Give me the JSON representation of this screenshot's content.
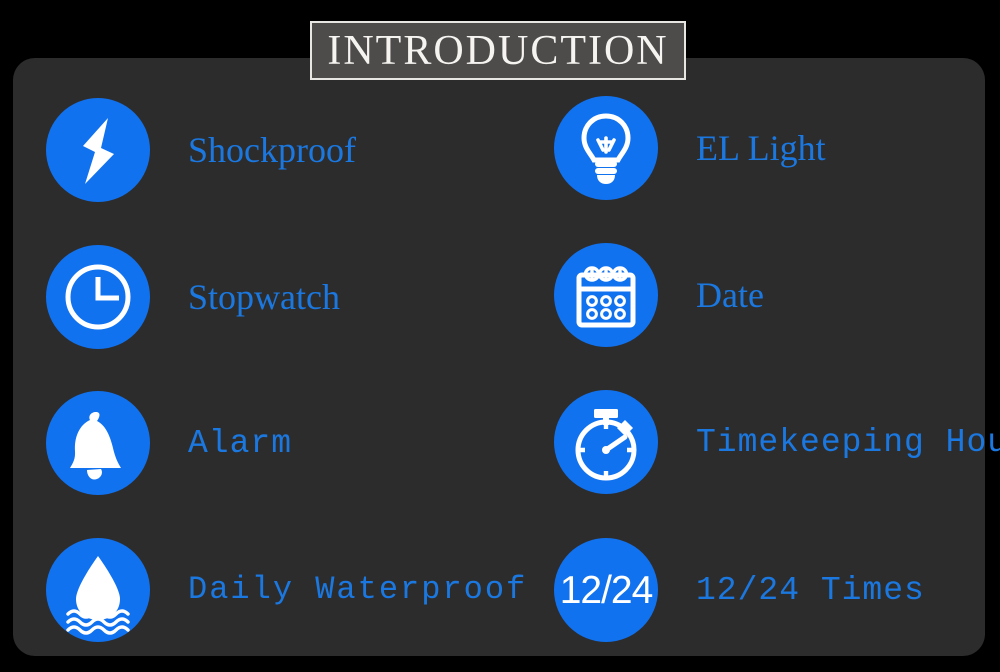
{
  "header": {
    "title": "INTRODUCTION"
  },
  "colors": {
    "page_background": "#000000",
    "panel_background": "#2d2c2c",
    "title_box_background": "#4e4b4b",
    "title_box_border": "#e8e6e3",
    "title_text": "#f6f4f1",
    "icon_circle": "#1172f0",
    "icon_glyph": "#ffffff",
    "label_text": "#1a78e0"
  },
  "features": {
    "left_column": [
      {
        "label": "Shockproof",
        "icon": "lightning-bolt-icon"
      },
      {
        "label": "Stopwatch",
        "icon": "clock-icon"
      },
      {
        "label": "Alarm",
        "icon": "bell-icon"
      },
      {
        "label": "Daily Waterproof",
        "icon": "water-drop-icon"
      }
    ],
    "right_column": [
      {
        "label": "EL Light",
        "icon": "light-bulb-icon"
      },
      {
        "label": "Date",
        "icon": "calendar-icon"
      },
      {
        "label": "Timekeeping Hour",
        "icon": "stopwatch-icon"
      },
      {
        "label": "12/24 Times",
        "icon": "twelve-twentyfour-icon",
        "icon_text": "12/24"
      }
    ]
  }
}
